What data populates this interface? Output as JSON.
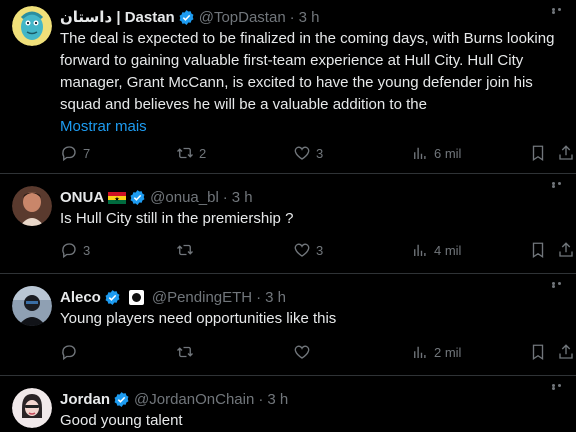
{
  "tweets": [
    {
      "name": "داستان | Dastan",
      "handle": "@TopDastan",
      "time": "3 h",
      "text": "The deal is expected to be finalized in the coming days, with Burns looking forward to gaining valuable first-team experience at Hull City. Hull City manager, Grant McCann, is excited to have the young defender join his squad and believes he will be a valuable addition to the",
      "show_more": "Mostrar mais",
      "replies": "7",
      "retweets": "2",
      "likes": "3",
      "views": "6 mil"
    },
    {
      "name": "ONUA",
      "handle": "@onua_bl",
      "time": "3 h",
      "text": "Is Hull City still in the premiership ?",
      "replies": "3",
      "retweets": "",
      "likes": "3",
      "views": "4 mil"
    },
    {
      "name": "Aleco",
      "handle": "@PendingETH",
      "time": "3 h",
      "text": "Young players need opportunities like this",
      "replies": "",
      "retweets": "",
      "likes": "",
      "views": "2 mil"
    },
    {
      "name": "Jordan",
      "handle": "@JordanOnChain",
      "time": "3 h",
      "text": "Good young talent"
    }
  ],
  "separator": "·",
  "colors": {
    "background": "#000000",
    "text": "#e7e9ea",
    "muted": "#71767b",
    "link": "#1d9bf0",
    "verified": "#1d9bf0",
    "divider": "#2f3336"
  }
}
